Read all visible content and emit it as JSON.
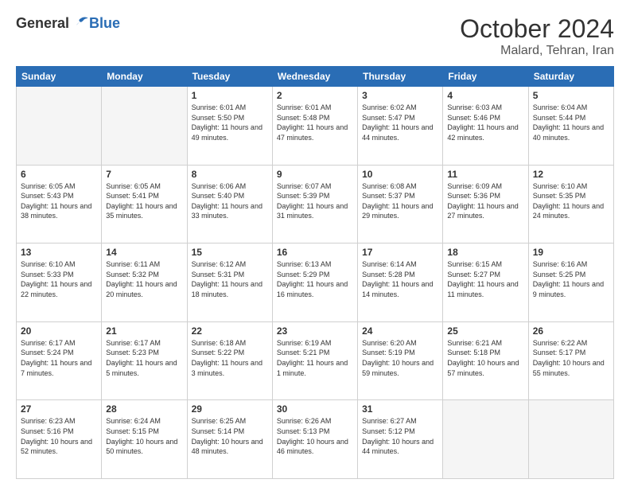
{
  "logo": {
    "general": "General",
    "blue": "Blue"
  },
  "header": {
    "month": "October 2024",
    "location": "Malard, Tehran, Iran"
  },
  "weekdays": [
    "Sunday",
    "Monday",
    "Tuesday",
    "Wednesday",
    "Thursday",
    "Friday",
    "Saturday"
  ],
  "weeks": [
    [
      {
        "day": "",
        "sunrise": "",
        "sunset": "",
        "daylight": ""
      },
      {
        "day": "",
        "sunrise": "",
        "sunset": "",
        "daylight": ""
      },
      {
        "day": "1",
        "sunrise": "Sunrise: 6:01 AM",
        "sunset": "Sunset: 5:50 PM",
        "daylight": "Daylight: 11 hours and 49 minutes."
      },
      {
        "day": "2",
        "sunrise": "Sunrise: 6:01 AM",
        "sunset": "Sunset: 5:48 PM",
        "daylight": "Daylight: 11 hours and 47 minutes."
      },
      {
        "day": "3",
        "sunrise": "Sunrise: 6:02 AM",
        "sunset": "Sunset: 5:47 PM",
        "daylight": "Daylight: 11 hours and 44 minutes."
      },
      {
        "day": "4",
        "sunrise": "Sunrise: 6:03 AM",
        "sunset": "Sunset: 5:46 PM",
        "daylight": "Daylight: 11 hours and 42 minutes."
      },
      {
        "day": "5",
        "sunrise": "Sunrise: 6:04 AM",
        "sunset": "Sunset: 5:44 PM",
        "daylight": "Daylight: 11 hours and 40 minutes."
      }
    ],
    [
      {
        "day": "6",
        "sunrise": "Sunrise: 6:05 AM",
        "sunset": "Sunset: 5:43 PM",
        "daylight": "Daylight: 11 hours and 38 minutes."
      },
      {
        "day": "7",
        "sunrise": "Sunrise: 6:05 AM",
        "sunset": "Sunset: 5:41 PM",
        "daylight": "Daylight: 11 hours and 35 minutes."
      },
      {
        "day": "8",
        "sunrise": "Sunrise: 6:06 AM",
        "sunset": "Sunset: 5:40 PM",
        "daylight": "Daylight: 11 hours and 33 minutes."
      },
      {
        "day": "9",
        "sunrise": "Sunrise: 6:07 AM",
        "sunset": "Sunset: 5:39 PM",
        "daylight": "Daylight: 11 hours and 31 minutes."
      },
      {
        "day": "10",
        "sunrise": "Sunrise: 6:08 AM",
        "sunset": "Sunset: 5:37 PM",
        "daylight": "Daylight: 11 hours and 29 minutes."
      },
      {
        "day": "11",
        "sunrise": "Sunrise: 6:09 AM",
        "sunset": "Sunset: 5:36 PM",
        "daylight": "Daylight: 11 hours and 27 minutes."
      },
      {
        "day": "12",
        "sunrise": "Sunrise: 6:10 AM",
        "sunset": "Sunset: 5:35 PM",
        "daylight": "Daylight: 11 hours and 24 minutes."
      }
    ],
    [
      {
        "day": "13",
        "sunrise": "Sunrise: 6:10 AM",
        "sunset": "Sunset: 5:33 PM",
        "daylight": "Daylight: 11 hours and 22 minutes."
      },
      {
        "day": "14",
        "sunrise": "Sunrise: 6:11 AM",
        "sunset": "Sunset: 5:32 PM",
        "daylight": "Daylight: 11 hours and 20 minutes."
      },
      {
        "day": "15",
        "sunrise": "Sunrise: 6:12 AM",
        "sunset": "Sunset: 5:31 PM",
        "daylight": "Daylight: 11 hours and 18 minutes."
      },
      {
        "day": "16",
        "sunrise": "Sunrise: 6:13 AM",
        "sunset": "Sunset: 5:29 PM",
        "daylight": "Daylight: 11 hours and 16 minutes."
      },
      {
        "day": "17",
        "sunrise": "Sunrise: 6:14 AM",
        "sunset": "Sunset: 5:28 PM",
        "daylight": "Daylight: 11 hours and 14 minutes."
      },
      {
        "day": "18",
        "sunrise": "Sunrise: 6:15 AM",
        "sunset": "Sunset: 5:27 PM",
        "daylight": "Daylight: 11 hours and 11 minutes."
      },
      {
        "day": "19",
        "sunrise": "Sunrise: 6:16 AM",
        "sunset": "Sunset: 5:25 PM",
        "daylight": "Daylight: 11 hours and 9 minutes."
      }
    ],
    [
      {
        "day": "20",
        "sunrise": "Sunrise: 6:17 AM",
        "sunset": "Sunset: 5:24 PM",
        "daylight": "Daylight: 11 hours and 7 minutes."
      },
      {
        "day": "21",
        "sunrise": "Sunrise: 6:17 AM",
        "sunset": "Sunset: 5:23 PM",
        "daylight": "Daylight: 11 hours and 5 minutes."
      },
      {
        "day": "22",
        "sunrise": "Sunrise: 6:18 AM",
        "sunset": "Sunset: 5:22 PM",
        "daylight": "Daylight: 11 hours and 3 minutes."
      },
      {
        "day": "23",
        "sunrise": "Sunrise: 6:19 AM",
        "sunset": "Sunset: 5:21 PM",
        "daylight": "Daylight: 11 hours and 1 minute."
      },
      {
        "day": "24",
        "sunrise": "Sunrise: 6:20 AM",
        "sunset": "Sunset: 5:19 PM",
        "daylight": "Daylight: 10 hours and 59 minutes."
      },
      {
        "day": "25",
        "sunrise": "Sunrise: 6:21 AM",
        "sunset": "Sunset: 5:18 PM",
        "daylight": "Daylight: 10 hours and 57 minutes."
      },
      {
        "day": "26",
        "sunrise": "Sunrise: 6:22 AM",
        "sunset": "Sunset: 5:17 PM",
        "daylight": "Daylight: 10 hours and 55 minutes."
      }
    ],
    [
      {
        "day": "27",
        "sunrise": "Sunrise: 6:23 AM",
        "sunset": "Sunset: 5:16 PM",
        "daylight": "Daylight: 10 hours and 52 minutes."
      },
      {
        "day": "28",
        "sunrise": "Sunrise: 6:24 AM",
        "sunset": "Sunset: 5:15 PM",
        "daylight": "Daylight: 10 hours and 50 minutes."
      },
      {
        "day": "29",
        "sunrise": "Sunrise: 6:25 AM",
        "sunset": "Sunset: 5:14 PM",
        "daylight": "Daylight: 10 hours and 48 minutes."
      },
      {
        "day": "30",
        "sunrise": "Sunrise: 6:26 AM",
        "sunset": "Sunset: 5:13 PM",
        "daylight": "Daylight: 10 hours and 46 minutes."
      },
      {
        "day": "31",
        "sunrise": "Sunrise: 6:27 AM",
        "sunset": "Sunset: 5:12 PM",
        "daylight": "Daylight: 10 hours and 44 minutes."
      },
      {
        "day": "",
        "sunrise": "",
        "sunset": "",
        "daylight": ""
      },
      {
        "day": "",
        "sunrise": "",
        "sunset": "",
        "daylight": ""
      }
    ]
  ]
}
